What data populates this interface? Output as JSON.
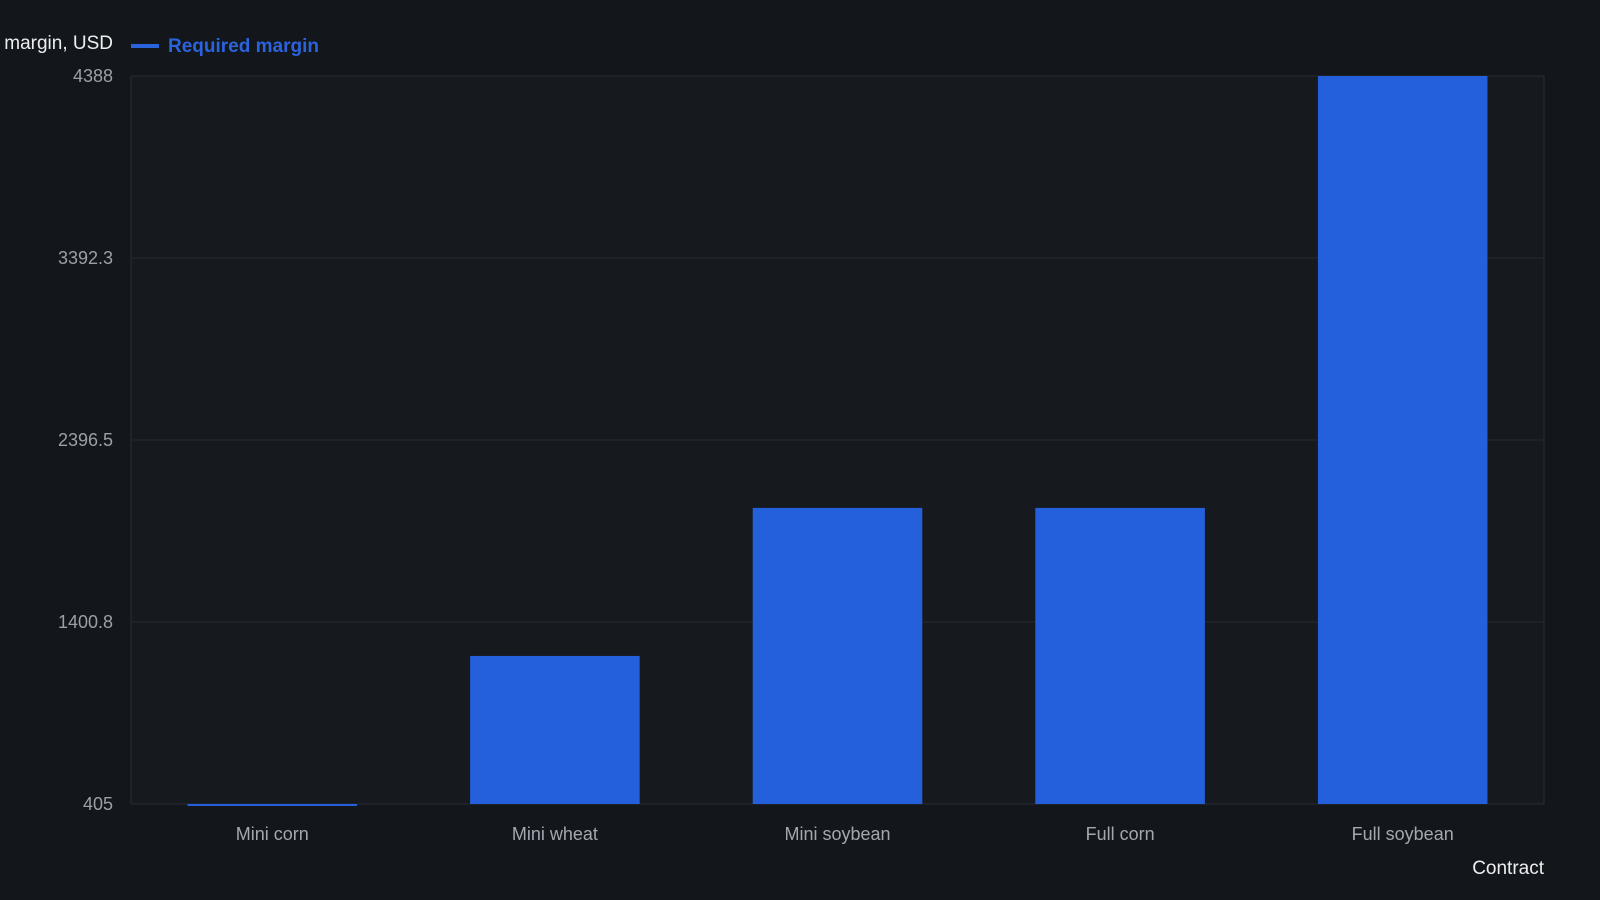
{
  "legend": {
    "label": "Required margin",
    "color": "#2b63dc"
  },
  "chart_data": {
    "type": "bar",
    "title": "",
    "xlabel": "Contract",
    "ylabel": "margin, USD",
    "categories": [
      "Mini corn",
      "Mini wheat",
      "Mini soybean",
      "Full corn",
      "Full soybean"
    ],
    "series": [
      {
        "name": "Required margin",
        "values": [
          405,
          1215,
          2025,
          2025,
          4388
        ],
        "color": "#2560dc"
      }
    ],
    "ylim": [
      405,
      4388
    ],
    "yticks": [
      "405",
      "1400.8",
      "2396.5",
      "3392.3",
      "4388"
    ],
    "grid": true,
    "legend_position": "top-left"
  }
}
